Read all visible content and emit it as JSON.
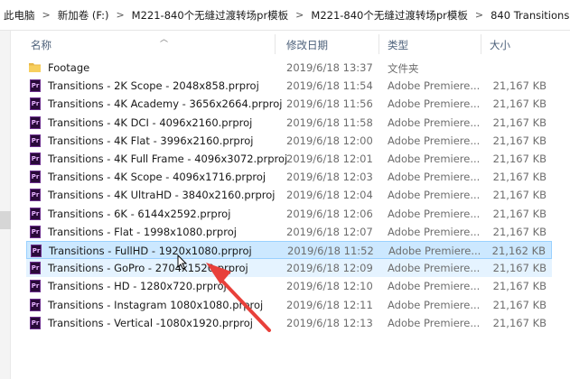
{
  "breadcrumb": {
    "items": [
      "此电脑",
      "新加卷 (F:)",
      "M221-840个无缝过渡转场pr模板",
      "M221-840个无缝过渡转场pr模板",
      "840 Transitions"
    ],
    "separator": ">"
  },
  "columns": {
    "name": "名称",
    "date": "修改日期",
    "type": "类型",
    "size": "大小"
  },
  "files": [
    {
      "name": "Footage",
      "date": "2019/6/18 13:37",
      "type": "文件夹",
      "size": "",
      "kind": "folder"
    },
    {
      "name": "Transitions - 2K Scope - 2048x858.prproj",
      "date": "2019/6/18 11:54",
      "type": "Adobe Premiere...",
      "size": "21,167 KB",
      "kind": "prproj"
    },
    {
      "name": "Transitions - 4K Academy - 3656x2664.prproj",
      "date": "2019/6/18 11:56",
      "type": "Adobe Premiere...",
      "size": "21,167 KB",
      "kind": "prproj"
    },
    {
      "name": "Transitions - 4K DCI - 4096x2160.prproj",
      "date": "2019/6/18 11:58",
      "type": "Adobe Premiere...",
      "size": "21,167 KB",
      "kind": "prproj"
    },
    {
      "name": "Transitions - 4K Flat - 3996x2160.prproj",
      "date": "2019/6/18 12:00",
      "type": "Adobe Premiere...",
      "size": "21,167 KB",
      "kind": "prproj"
    },
    {
      "name": "Transitions - 4K Full Frame - 4096x3072.prproj",
      "date": "2019/6/18 12:01",
      "type": "Adobe Premiere...",
      "size": "21,167 KB",
      "kind": "prproj"
    },
    {
      "name": "Transitions - 4K Scope - 4096x1716.prproj",
      "date": "2019/6/18 12:03",
      "type": "Adobe Premiere...",
      "size": "21,167 KB",
      "kind": "prproj"
    },
    {
      "name": "Transitions - 4K UltraHD - 3840x2160.prproj",
      "date": "2019/6/18 12:04",
      "type": "Adobe Premiere...",
      "size": "21,167 KB",
      "kind": "prproj"
    },
    {
      "name": "Transitions - 6K - 6144x2592.prproj",
      "date": "2019/6/18 12:06",
      "type": "Adobe Premiere...",
      "size": "21,167 KB",
      "kind": "prproj"
    },
    {
      "name": "Transitions - Flat - 1998x1080.prproj",
      "date": "2019/6/18 12:07",
      "type": "Adobe Premiere...",
      "size": "21,167 KB",
      "kind": "prproj"
    },
    {
      "name": "Transitions - FullHD - 1920x1080.prproj",
      "date": "2019/6/18 11:52",
      "type": "Adobe Premiere...",
      "size": "21,162 KB",
      "kind": "prproj",
      "state": "selected"
    },
    {
      "name": "Transitions - GoPro - 2704x1520.prproj",
      "date": "2019/6/18 12:09",
      "type": "Adobe Premiere...",
      "size": "21,167 KB",
      "kind": "prproj",
      "state": "hover"
    },
    {
      "name": "Transitions - HD - 1280x720.prproj",
      "date": "2019/6/18 12:10",
      "type": "Adobe Premiere...",
      "size": "21,167 KB",
      "kind": "prproj"
    },
    {
      "name": "Transitions - Instagram 1080x1080.prproj",
      "date": "2019/6/18 12:11",
      "type": "Adobe Premiere...",
      "size": "21,167 KB",
      "kind": "prproj"
    },
    {
      "name": "Transitions - Vertical -1080x1920.prproj",
      "date": "2019/6/18 12:13",
      "type": "Adobe Premiere...",
      "size": "21,167 KB",
      "kind": "prproj"
    }
  ],
  "colors": {
    "selected_bg": "#cce8ff",
    "hover_bg": "#e5f3ff",
    "annotation_arrow": "#e8403a",
    "pr_icon_bg": "#2a0a3a",
    "pr_icon_text": "#e7b3ff"
  },
  "icons": {
    "folder": "folder-icon",
    "prproj": "premiere-file-icon",
    "pr_glyph": "Pr"
  }
}
